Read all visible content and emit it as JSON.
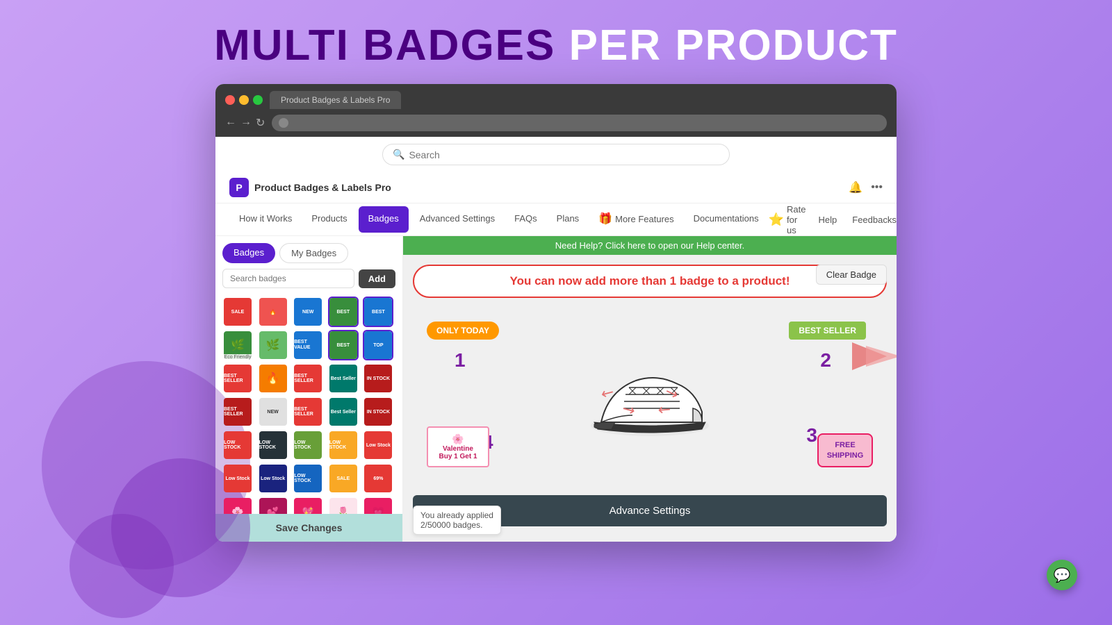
{
  "page": {
    "title_purple": "MULTI BADGES",
    "title_white": "PER PRODUCT"
  },
  "browser": {
    "tab_text": "Product Badges & Labels Pro",
    "address_text": ""
  },
  "search": {
    "placeholder": "Search"
  },
  "app": {
    "name": "Product Badges & Labels Pro",
    "logo_letter": "P"
  },
  "nav": {
    "tabs": [
      {
        "label": "How it Works",
        "active": false
      },
      {
        "label": "Products",
        "active": false
      },
      {
        "label": "Badges",
        "active": true
      },
      {
        "label": "Advanced Settings",
        "active": false
      },
      {
        "label": "FAQs",
        "active": false
      },
      {
        "label": "Plans",
        "active": false
      },
      {
        "label": "More Features",
        "active": false,
        "has_icon": true
      },
      {
        "label": "Documentations",
        "active": false
      }
    ],
    "right_tabs": [
      {
        "label": "Rate for us"
      },
      {
        "label": "Help"
      },
      {
        "label": "Feedbacks"
      }
    ]
  },
  "sidebar": {
    "tab_badges": "Badges",
    "tab_my_badges": "My Badges",
    "search_placeholder": "Search badges",
    "add_button": "Add",
    "save_button": "Save Changes"
  },
  "main": {
    "help_banner": "Need Help? Click here to open our Help center.",
    "info_banner": "You can now add more than 1 badge to a product!",
    "clear_badge_btn": "Clear Badge",
    "advance_settings_btn": "Advance Settings",
    "applied_notice_line1": "You already applied",
    "applied_notice_line2": "2/50000 badges.",
    "badge_only_today": "ONLY TODAY",
    "badge_best_seller": "BEST SELLER",
    "badge_free_shipping_line1": "FREE",
    "badge_free_shipping_line2": "SHIPPING",
    "badge_valentine_label": "Valentine",
    "badge_valentine_sub": "Buy 1 Get 1",
    "num_labels": [
      "1",
      "2",
      "3",
      "4"
    ]
  },
  "chat": {
    "icon": "💬"
  }
}
